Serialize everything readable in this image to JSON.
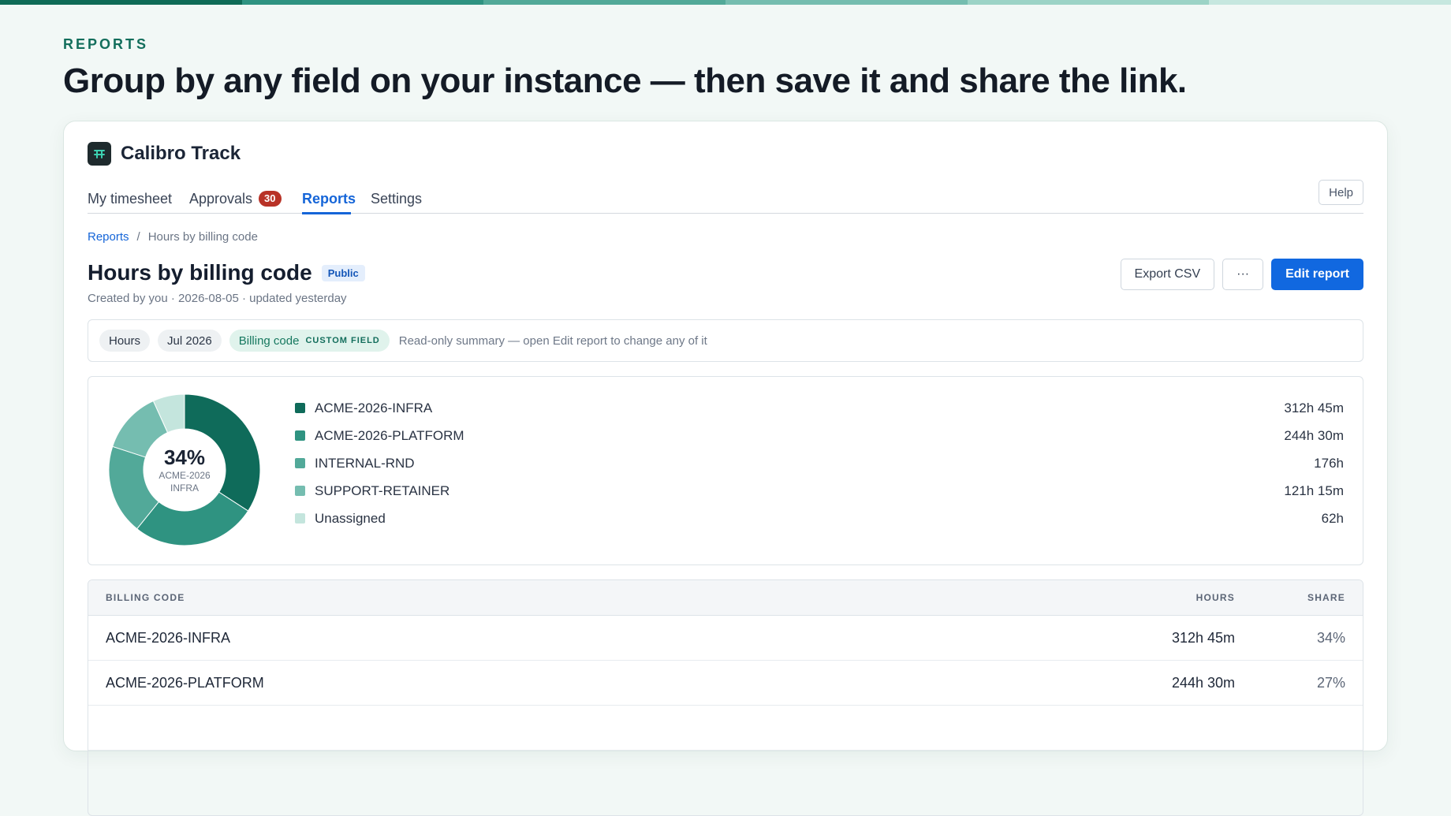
{
  "page": {
    "eyebrow": "REPORTS",
    "headline": "Group by any field on your instance — then save it and share the link.",
    "progress_colors": [
      "#0f6b57",
      "#2f9381",
      "#52a998",
      "#75bdaf",
      "#9cd3c6",
      "#c6e7df"
    ]
  },
  "app": {
    "name": "Calibro Track",
    "logo_glyph": "𐩡",
    "logo_color": "#3ccfb0"
  },
  "nav": {
    "tabs": [
      {
        "label": "My timesheet"
      },
      {
        "label": "Approvals",
        "badge": "30"
      },
      {
        "label": "Reports",
        "active": true
      },
      {
        "label": "Settings"
      }
    ],
    "help_label": "Help"
  },
  "breadcrumb": {
    "root": "Reports",
    "separator": "/",
    "current": "Hours by billing code"
  },
  "report": {
    "title": "Hours by billing code",
    "visibility": "Public",
    "meta": "Created by you · 2026-08-05 · updated yesterday",
    "actions": {
      "export": "Export CSV",
      "more": "···",
      "edit": "Edit report"
    }
  },
  "filters": {
    "metric": "Hours",
    "period": "Jul 2026",
    "group_by": "Billing code",
    "group_by_tag": "CUSTOM FIELD",
    "note": "Read-only summary — open Edit report to change any of it"
  },
  "chart_data": {
    "type": "pie",
    "style": "donut",
    "center_value": "34%",
    "center_label": "ACME-2026 INFRA",
    "slices": [
      {
        "label": "ACME-2026-INFRA",
        "display": "312h 45m",
        "hours": 312.75,
        "color": "#0f6b5a"
      },
      {
        "label": "ACME-2026-PLATFORM",
        "display": "244h 30m",
        "hours": 244.5,
        "color": "#2f9381"
      },
      {
        "label": "INTERNAL-RND",
        "display": "176h",
        "hours": 176,
        "color": "#52a999"
      },
      {
        "label": "SUPPORT-RETAINER",
        "display": "121h 15m",
        "hours": 121.25,
        "color": "#75bdb0"
      },
      {
        "label": "Unassigned",
        "display": "62h",
        "hours": 62,
        "color": "#c4e5dd"
      }
    ]
  },
  "table": {
    "headers": {
      "code": "BILLING CODE",
      "hours": "HOURS",
      "share": "SHARE"
    },
    "rows": [
      {
        "code": "ACME-2026-INFRA",
        "hours": "312h 45m",
        "share": "34%"
      },
      {
        "code": "ACME-2026-PLATFORM",
        "hours": "244h 30m",
        "share": "27%"
      }
    ]
  }
}
